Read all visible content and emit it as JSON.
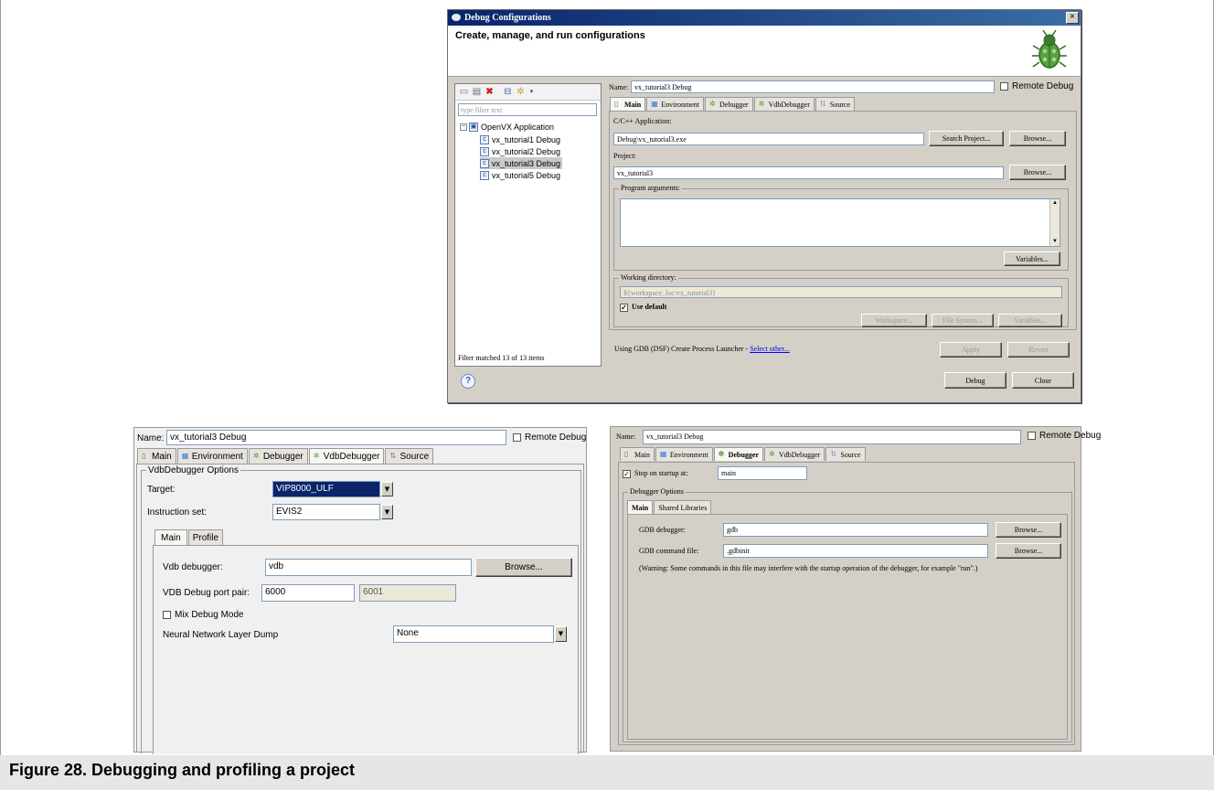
{
  "caption": "Figure 28.  Debugging and profiling a project",
  "dialog": {
    "title": "Debug Configurations",
    "banner": "Create, manage, and run configurations",
    "filter_placeholder": "type filter text",
    "tree": {
      "root": "OpenVX Application",
      "items": [
        "vx_tutorial1 Debug",
        "vx_tutorial2 Debug",
        "vx_tutorial3 Debug",
        "vx_tutorial5 Debug"
      ],
      "selected_index": 2
    },
    "filter_status": "Filter matched 13 of 13 items",
    "name_label": "Name:",
    "name_value": "vx_tutorial3 Debug",
    "remote_debug": "Remote Debug",
    "tabs": [
      "Main",
      "Environment",
      "Debugger",
      "VdbDebugger",
      "Source"
    ],
    "active_tab": "Main",
    "cpp_app_label": "C/C++ Application:",
    "cpp_app_value": "Debug\\vx_tutorial3.exe",
    "search_project": "Search Project...",
    "browse": "Browse...",
    "project_label": "Project:",
    "project_value": "vx_tutorial3",
    "program_args": "Program arguments:",
    "variables": "Variables...",
    "working_dir": "Working directory:",
    "working_dir_value": "${workspace_loc:vx_tutorial3}",
    "use_default": "Use default",
    "workspace_btn": "Workspace...",
    "filesystem_btn": "File System...",
    "variables2_btn": "Variables...",
    "launcher_text": "Using GDB (DSF) Create Process Launcher - ",
    "select_other": "Select other...",
    "apply": "Apply",
    "revert": "Revert",
    "debug": "Debug",
    "close": "Close",
    "close_glyph": "×"
  },
  "vdb_panel": {
    "name_label": "Name:",
    "name_value": "vx_tutorial3 Debug",
    "remote_debug": "Remote Debug",
    "tabs": [
      "Main",
      "Environment",
      "Debugger",
      "VdbDebugger",
      "Source"
    ],
    "active_tab": "VdbDebugger",
    "group_title": "VdbDebugger Options",
    "target_label": "Target:",
    "target_value": "VIP8000_ULF",
    "instruction_label": "Instruction set:",
    "instruction_value": "EVIS2",
    "subtabs": [
      "Main",
      "Profile"
    ],
    "vdb_debugger_label": "Vdb debugger:",
    "vdb_debugger_value": "vdb",
    "browse": "Browse...",
    "port_label": "VDB Debug port pair:",
    "port1": "6000",
    "port2": "6001",
    "mix_debug": "Mix Debug Mode",
    "nn_dump_label": "Neural Network Layer Dump",
    "nn_dump_value": "None"
  },
  "gdb_panel": {
    "name_label": "Name:",
    "name_value": "vx_tutorial3 Debug",
    "remote_debug": "Remote Debug",
    "tabs": [
      "Main",
      "Environment",
      "Debugger",
      "VdbDebugger",
      "Source"
    ],
    "active_tab": "Debugger",
    "stop_on_startup": "Stop on startup at:",
    "stop_value": "main",
    "group_title": "Debugger Options",
    "subtabs": [
      "Main",
      "Shared Libraries"
    ],
    "gdb_debugger_label": "GDB debugger:",
    "gdb_debugger_value": "gdb",
    "gdb_cmd_label": "GDB command file:",
    "gdb_cmd_value": ".gdbinit",
    "browse": "Browse...",
    "warning": "(Warning: Some commands in this file may interfere with the startup operation of the debugger, for example \"run\".)"
  }
}
